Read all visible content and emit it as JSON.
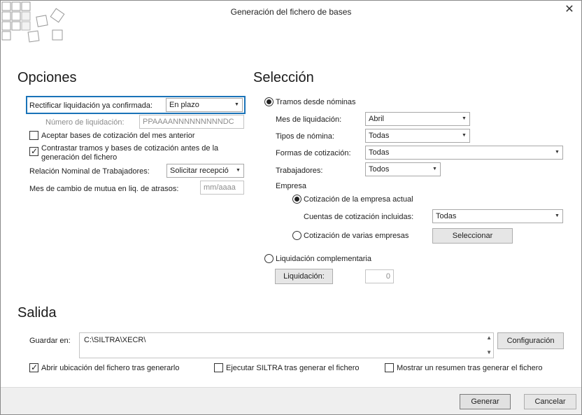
{
  "window": {
    "title": "Generación del fichero de bases",
    "close_glyph": "✕"
  },
  "opciones": {
    "title": "Opciones",
    "rectificar_label": "Rectificar liquidación ya confirmada:",
    "rectificar_value": "En plazo",
    "numero_label": "Número de liquidación:",
    "numero_placeholder": "PPAAAANNNNNNNNNDC",
    "aceptar_label": "Aceptar bases de cotización del mes anterior",
    "aceptar_checked": false,
    "contrastar_label_line1": "Contrastar tramos y bases de cotización antes de la",
    "contrastar_label_line2": "generación del fichero",
    "contrastar_checked": true,
    "relacion_label": "Relación Nominal de Trabajadores:",
    "relacion_value": "Solicitar recepció",
    "mes_cambio_label": "Mes de cambio de mutua en liq. de atrasos:",
    "mes_cambio_placeholder": "mm/aaaa"
  },
  "seleccion": {
    "title": "Selección",
    "tramos_label": "Tramos desde nóminas",
    "tramos_selected": true,
    "mes_label": "Mes de liquidación:",
    "mes_value": "Abril",
    "tipos_label": "Tipos de nómina:",
    "tipos_value": "Todas",
    "formas_label": "Formas de cotización:",
    "formas_value": "Todas",
    "trabajadores_label": "Trabajadores:",
    "trabajadores_value": "Todos",
    "empresa_label": "Empresa",
    "cotizacion_actual_label": "Cotización de la empresa actual",
    "cotizacion_actual_selected": true,
    "cuentas_label": "Cuentas de cotización incluidas:",
    "cuentas_value": "Todas",
    "varias_label": "Cotización de varias empresas",
    "varias_selected": false,
    "seleccionar_button": "Seleccionar",
    "complementaria_label": "Liquidación complementaria",
    "complementaria_selected": false,
    "liquidacion_button": "Liquidación:",
    "liquidacion_value": "0"
  },
  "salida": {
    "title": "Salida",
    "guardar_label": "Guardar en:",
    "guardar_value": "C:\\SILTRA\\XECR\\",
    "configuracion_button": "Configuración",
    "abrir_label": "Abrir ubicación del fichero tras generarlo",
    "abrir_checked": true,
    "ejecutar_label": "Ejecutar SILTRA tras generar el fichero",
    "ejecutar_checked": false,
    "mostrar_label": "Mostrar un resumen tras generar el fichero",
    "mostrar_checked": false
  },
  "footer": {
    "generar_button": "Generar",
    "cancelar_button": "Cancelar"
  },
  "icons": {
    "dropdown_arrow": "▼",
    "check_mark": "✓",
    "scroll_up": "▲",
    "scroll_down": "▼"
  },
  "colors": {
    "focus_border": "#1a73b8",
    "footer_bg": "#efefef"
  }
}
